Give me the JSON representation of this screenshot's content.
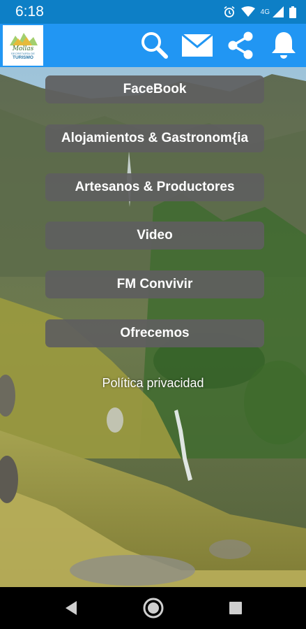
{
  "status_bar": {
    "time": "6:18",
    "network": "4G"
  },
  "app_bar": {
    "logo": {
      "top_text": "Mollas",
      "sub_text": "SECRETARÍA DE",
      "main_text": "TURISMO"
    },
    "icons": [
      "search-icon",
      "mail-icon",
      "share-icon",
      "bell-icon"
    ]
  },
  "menu": {
    "items": [
      {
        "label": "FaceBook"
      },
      {
        "label": "Alojamientos & Gastronom{ia"
      },
      {
        "label": "Artesanos & Productores"
      },
      {
        "label": "Video"
      },
      {
        "label": "FM Convivir"
      },
      {
        "label": "Ofrecemos"
      }
    ],
    "privacy_label": "Política privacidad"
  },
  "colors": {
    "status_bar": "#0d7fc6",
    "app_bar": "#2196f3",
    "button_bg": "#5f5f5f"
  }
}
